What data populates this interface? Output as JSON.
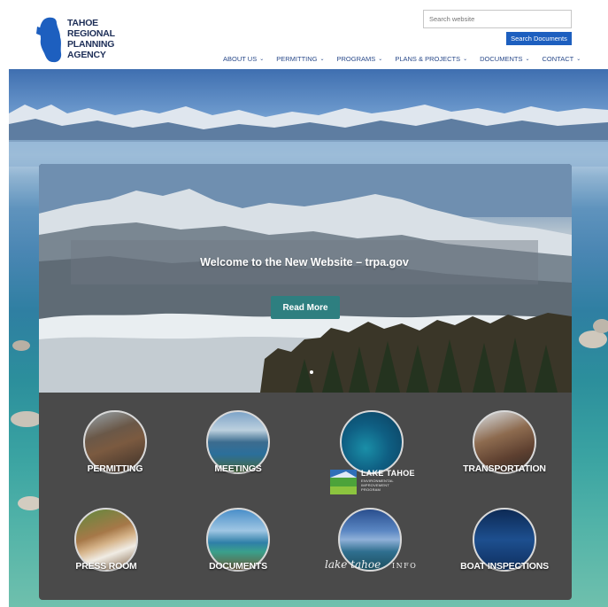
{
  "logo": {
    "line1": "TAHOE",
    "line2": "REGIONAL",
    "line3": "PLANNING",
    "line4": "AGENCY",
    "brand_color": "#1d5fbf"
  },
  "search": {
    "placeholder": "Search website",
    "docs_button": "Search Documents"
  },
  "nav": {
    "items": [
      {
        "label": "ABOUT US"
      },
      {
        "label": "PERMITTING"
      },
      {
        "label": "PROGRAMS"
      },
      {
        "label": "PLANS & PROJECTS"
      },
      {
        "label": "DOCUMENTS"
      },
      {
        "label": "CONTACT"
      }
    ],
    "chevron": "⌄"
  },
  "slider": {
    "caption": "Welcome to the New Website – trpa.gov",
    "button": "Read More",
    "accent": "#2e7f80"
  },
  "tiles": [
    {
      "label": "PERMITTING",
      "icon": "permitting-photo"
    },
    {
      "label": "MEETINGS",
      "icon": "meetings-photo"
    },
    {
      "label": "",
      "icon": "lake-tahoe-eip-photo"
    },
    {
      "label": "TRANSPORTATION",
      "icon": "transportation-photo"
    },
    {
      "label": "PRESS ROOM",
      "icon": "press-room-photo"
    },
    {
      "label": "DOCUMENTS",
      "icon": "documents-photo"
    },
    {
      "label": "",
      "icon": "lake-tahoe-info-photo"
    },
    {
      "label": "BOAT INSPECTIONS",
      "icon": "boat-inspections-photo"
    }
  ],
  "eip": {
    "title": "LAKE TAHOE",
    "sub1": "ENVIRONMENTAL",
    "sub2": "IMPROVEMENT",
    "sub3": "PROGRAM"
  },
  "lake_info": {
    "script": "lake tahoe",
    "word": "INFO"
  }
}
